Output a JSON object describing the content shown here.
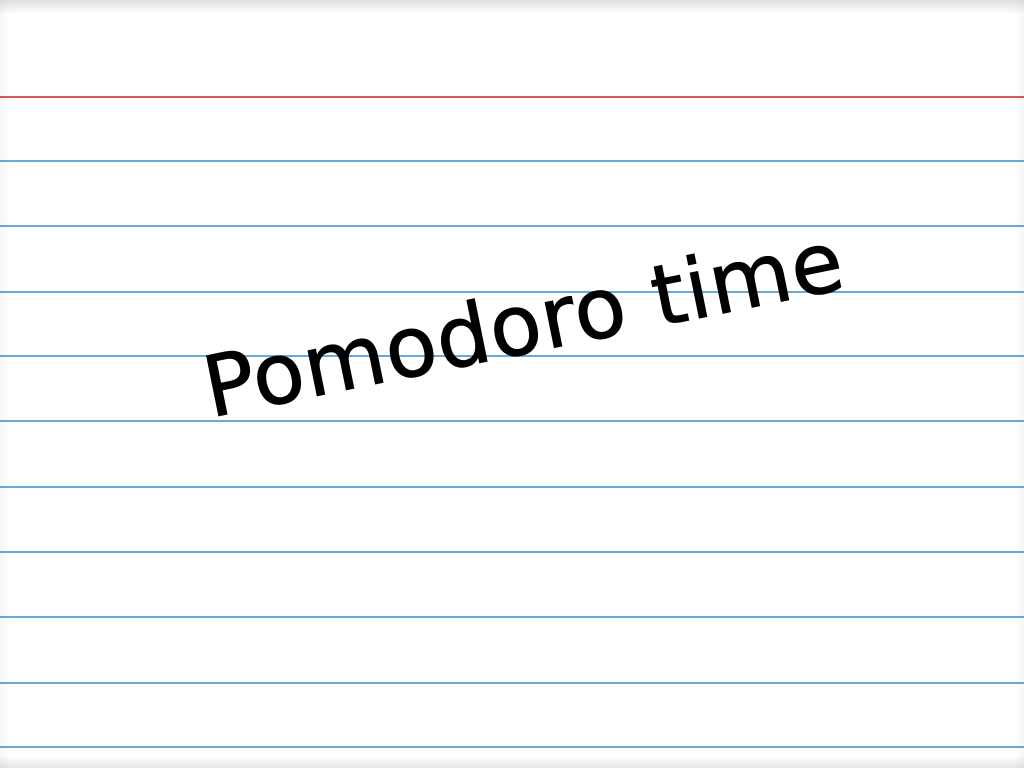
{
  "card": {
    "handwriting": "Pomodoro time",
    "ruled_lines": 11,
    "colors": {
      "paper": "#ffffff",
      "margin_line": "#d85a5a",
      "ruled_line": "#6aa9d8",
      "ink": "#000000"
    }
  }
}
